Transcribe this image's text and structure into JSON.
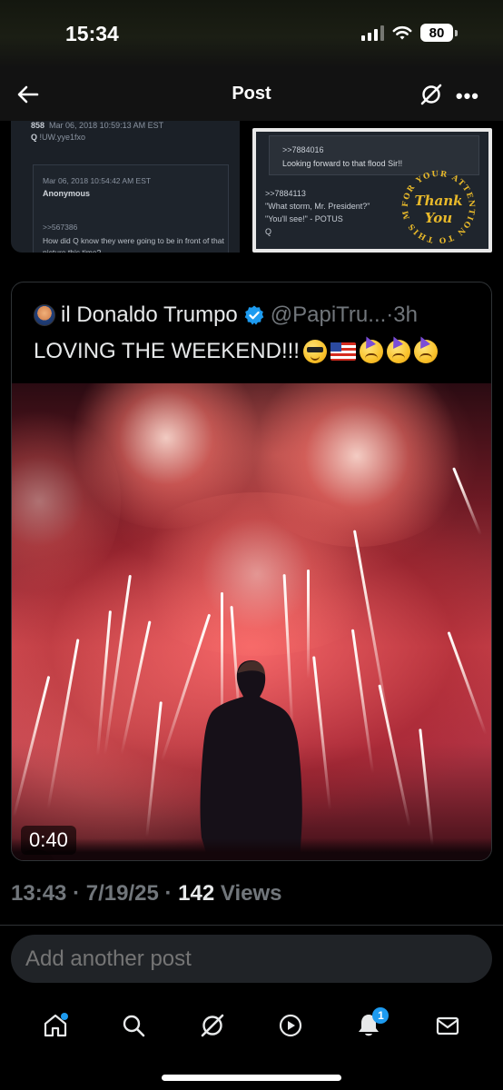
{
  "status_bar": {
    "time": "15:34",
    "battery": "80"
  },
  "header": {
    "title": "Post"
  },
  "prev_post_image": {
    "left": {
      "meta_num": "858",
      "meta_date": "Mar 06, 2018 10:59:13 AM EST",
      "trip_q": "Q",
      "trip_code": "!UW.yye1fxo",
      "inner_date": "Mar 06, 2018 10:54:42 AM EST",
      "inner_name": "Anonymous",
      "inner_ref": ">>567386",
      "inner_text": "How did Q know they were going to be in front of that picture this time?"
    },
    "right": {
      "box_ref": ">>7884016",
      "box_text": "Looking forward to that flood Sir!!",
      "ref": ">>7884113",
      "line1": "\"What storm, Mr. President?\"",
      "line2": "\"You'll see!\" - POTUS",
      "line3": "Q",
      "seal_words": "FOR YOUR ATTENTION TO THIS MATTER",
      "seal_thank": "Thank",
      "seal_you": "You"
    }
  },
  "quote": {
    "author": "il Donaldo Trumpo",
    "handle": "@PapiTru...",
    "dot": "·",
    "time": "3h",
    "text": "LOVING THE WEEKEND!!!",
    "video_duration": "0:40"
  },
  "post_meta": {
    "time": "13:43",
    "date": "7/19/25",
    "views_count": "142",
    "views_label": "Views",
    "sep": "·"
  },
  "reply": {
    "placeholder": "Add another post"
  },
  "tabbar": {
    "notifications_badge": "1"
  },
  "colors": {
    "accent": "#1d9bf0",
    "background": "#000000",
    "muted": "#71767b"
  },
  "icons": [
    "back-arrow-icon",
    "grok-icon",
    "more-icon",
    "verified-icon",
    "home-icon",
    "search-icon",
    "grok-tab-icon",
    "video-icon",
    "bell-icon",
    "mail-icon"
  ]
}
